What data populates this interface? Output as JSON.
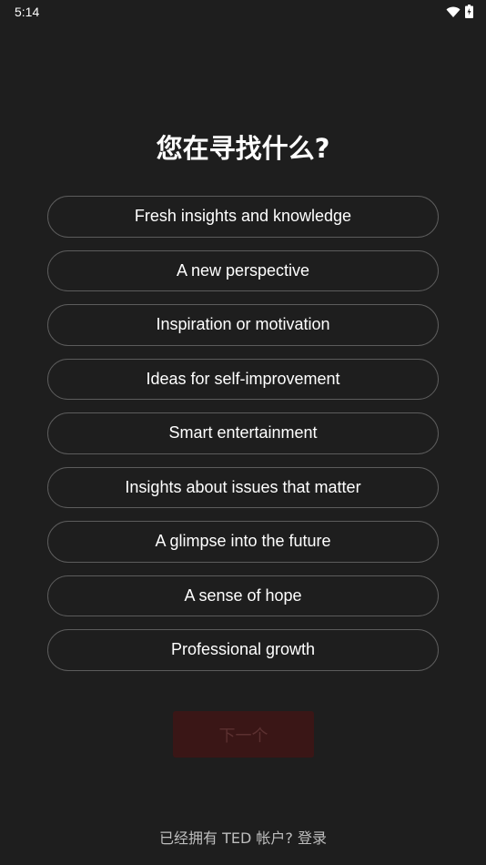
{
  "status_bar": {
    "time": "5:14",
    "icons": [
      "wifi-icon",
      "battery-icon"
    ]
  },
  "title": "您在寻找什么?",
  "options": [
    {
      "label": "Fresh insights and knowledge"
    },
    {
      "label": "A new perspective"
    },
    {
      "label": "Inspiration or motivation"
    },
    {
      "label": "Ideas for self-improvement"
    },
    {
      "label": "Smart entertainment"
    },
    {
      "label": "Insights about issues that matter"
    },
    {
      "label": "A glimpse into the future"
    },
    {
      "label": "A sense of hope"
    },
    {
      "label": "Professional growth"
    }
  ],
  "next_button": {
    "label": "下一个",
    "enabled": false
  },
  "footer": {
    "login_prompt": "已经拥有 TED 帐户? 登录"
  },
  "colors": {
    "background": "#1e1e1e",
    "option_border": "#5c5c5c",
    "next_button_bg": "#3a1616",
    "next_button_text": "#5b3030",
    "footer_text": "#bdbdbd"
  }
}
